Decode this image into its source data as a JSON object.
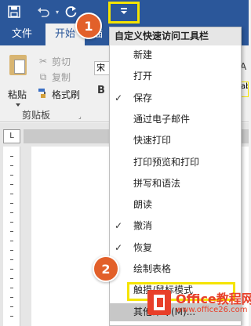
{
  "qat": {
    "customize_tooltip": "自定义快速访问工具栏"
  },
  "tabs": [
    {
      "label": "文件"
    },
    {
      "label": "开始"
    },
    {
      "label": "插"
    }
  ],
  "ribbon": {
    "paste_label": "粘贴",
    "cut_label": "剪切",
    "copy_label": "复制",
    "format_painter_label": "格式刷",
    "clipboard_group": "剪贴板",
    "font_box_value": "宋",
    "bold_label": "B",
    "right_letter": "A",
    "right_partial": "ab"
  },
  "ruler": {
    "tab_selector": "L"
  },
  "menu": {
    "header": "自定义快速访问工具栏",
    "items": [
      {
        "label": "新建",
        "checked": false
      },
      {
        "label": "打开",
        "checked": false
      },
      {
        "label": "保存",
        "checked": true
      },
      {
        "label": "通过电子邮件",
        "checked": false
      },
      {
        "label": "快速打印",
        "checked": false
      },
      {
        "label": "打印预览和打印",
        "checked": false
      },
      {
        "label": "拼写和语法",
        "checked": false
      },
      {
        "label": "朗读",
        "checked": false
      },
      {
        "label": "撤消",
        "checked": true
      },
      {
        "label": "恢复",
        "checked": true
      },
      {
        "label": "绘制表格",
        "checked": false
      },
      {
        "label": "触摸/鼠标模式",
        "checked": false
      },
      {
        "label": "其他命令(M)...",
        "checked": false
      }
    ]
  },
  "steps": [
    "1",
    "2"
  ],
  "watermark": {
    "line1": "Office教程网",
    "line2": "www.office26.com"
  },
  "colors": {
    "ribbon_blue": "#2b579a",
    "highlight_yellow": "#f5e400",
    "badge_orange": "#e2602a"
  }
}
